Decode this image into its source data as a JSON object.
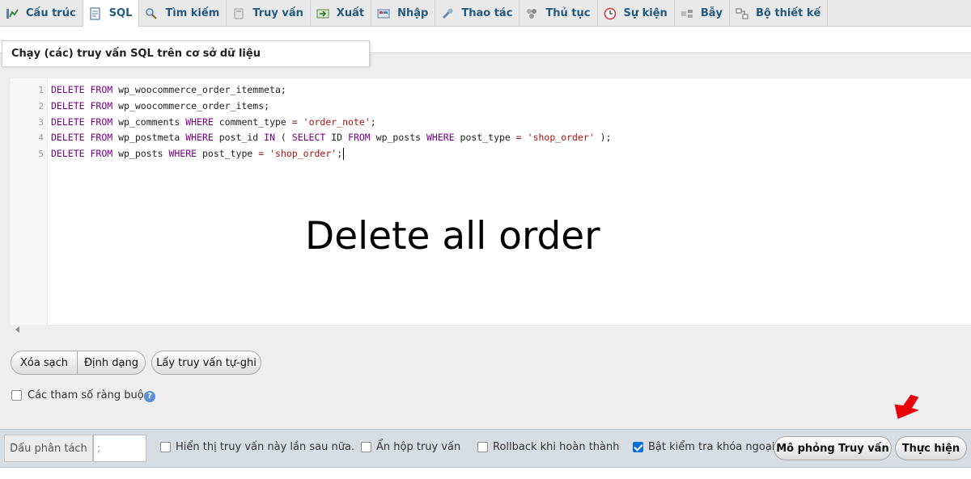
{
  "tabs": [
    {
      "label": "Cấu trúc",
      "icon": "structure-icon",
      "active": false
    },
    {
      "label": "SQL",
      "icon": "sql-icon",
      "active": true
    },
    {
      "label": "Tìm kiếm",
      "icon": "search-icon",
      "active": false
    },
    {
      "label": "Truy vấn",
      "icon": "query-icon",
      "active": false
    },
    {
      "label": "Xuất",
      "icon": "export-icon",
      "active": false
    },
    {
      "label": "Nhập",
      "icon": "import-icon",
      "active": false
    },
    {
      "label": "Thao tác",
      "icon": "wrench-icon",
      "active": false
    },
    {
      "label": "Thủ tục",
      "icon": "routines-icon",
      "active": false
    },
    {
      "label": "Sự kiện",
      "icon": "clock-icon",
      "active": false
    },
    {
      "label": "Bẫy",
      "icon": "triggers-icon",
      "active": false
    },
    {
      "label": "Bộ thiết kế",
      "icon": "designer-icon",
      "active": false
    }
  ],
  "panel": {
    "title": "Chạy (các) truy vấn SQL trên cơ sở dữ liệu"
  },
  "editor": {
    "line_numbers": [
      "1",
      "2",
      "3",
      "4",
      "5"
    ],
    "lines": [
      [
        {
          "t": "DELETE",
          "c": "kw"
        },
        {
          "t": " "
        },
        {
          "t": "FROM",
          "c": "kw"
        },
        {
          "t": " wp_woocommerce_order_itemmeta;"
        }
      ],
      [
        {
          "t": "DELETE",
          "c": "kw"
        },
        {
          "t": " "
        },
        {
          "t": "FROM",
          "c": "kw"
        },
        {
          "t": " wp_woocommerce_order_items;"
        }
      ],
      [
        {
          "t": "DELETE",
          "c": "kw"
        },
        {
          "t": " "
        },
        {
          "t": "FROM",
          "c": "kw"
        },
        {
          "t": " wp_comments "
        },
        {
          "t": "WHERE",
          "c": "kw"
        },
        {
          "t": " comment_type "
        },
        {
          "t": "=",
          "c": "op"
        },
        {
          "t": " "
        },
        {
          "t": "'order_note'",
          "c": "str"
        },
        {
          "t": ";"
        }
      ],
      [
        {
          "t": "DELETE",
          "c": "kw"
        },
        {
          "t": " "
        },
        {
          "t": "FROM",
          "c": "kw"
        },
        {
          "t": " wp_postmeta "
        },
        {
          "t": "WHERE",
          "c": "kw"
        },
        {
          "t": " post_id "
        },
        {
          "t": "IN",
          "c": "kw"
        },
        {
          "t": " ( "
        },
        {
          "t": "SELECT",
          "c": "kw"
        },
        {
          "t": " ID "
        },
        {
          "t": "FROM",
          "c": "kw"
        },
        {
          "t": " wp_posts "
        },
        {
          "t": "WHERE",
          "c": "kw"
        },
        {
          "t": " post_type "
        },
        {
          "t": "=",
          "c": "op"
        },
        {
          "t": " "
        },
        {
          "t": "'shop_order'",
          "c": "str"
        },
        {
          "t": " );"
        }
      ],
      [
        {
          "t": "DELETE",
          "c": "kw"
        },
        {
          "t": " "
        },
        {
          "t": "FROM",
          "c": "kw"
        },
        {
          "t": " wp_posts "
        },
        {
          "t": "WHERE",
          "c": "kw"
        },
        {
          "t": " post_type "
        },
        {
          "t": "=",
          "c": "op"
        },
        {
          "t": " "
        },
        {
          "t": "'shop_order'",
          "c": "str"
        },
        {
          "t": ";"
        }
      ]
    ]
  },
  "overlay_text": "Delete all order",
  "buttons": {
    "clear": "Xóa sạch",
    "format": "Định dạng",
    "get_autosaved": "Lấy truy vấn tự-ghi",
    "simulate": "Mô phỏng Truy vấn",
    "go": "Thực hiện"
  },
  "bind_params": {
    "label": "Các tham số ràng buộc",
    "checked": false
  },
  "bottom": {
    "delimiter_label": "Dấu phân tách",
    "delimiter_value": ";",
    "options": [
      {
        "label": "Hiển thị truy vấn này lần sau nữa.",
        "checked": false
      },
      {
        "label": "Ẩn hộp truy vấn",
        "checked": false
      },
      {
        "label": "Rollback khi hoàn thành",
        "checked": false
      },
      {
        "label": "Bật kiểm tra khóa ngoại",
        "checked": true
      }
    ]
  },
  "colors": {
    "tab_text": "#235a81",
    "keyword": "#770088",
    "string": "#aa1111",
    "operator": "#981a1a",
    "checkbox_on": "#0b6fd6",
    "arrow": "#e8000b"
  }
}
